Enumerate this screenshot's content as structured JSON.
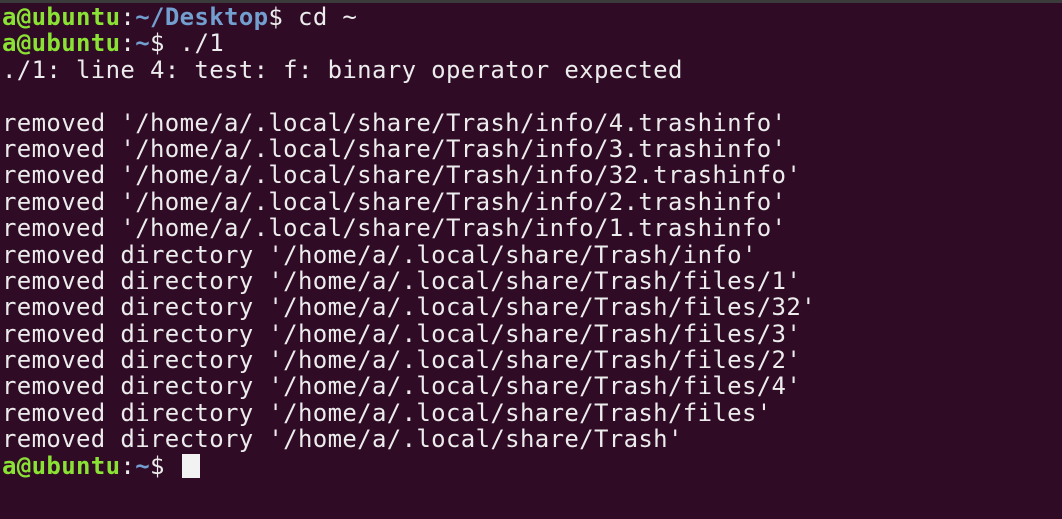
{
  "prompts": [
    {
      "user": "a@ubuntu",
      "sep": ":",
      "path": "~/Desktop",
      "symbol": "$ ",
      "command": "cd ~"
    },
    {
      "user": "a@ubuntu",
      "sep": ":",
      "path": "~",
      "symbol": "$ ",
      "command": "./1"
    },
    {
      "user": "a@ubuntu",
      "sep": ":",
      "path": "~",
      "symbol": "$ ",
      "command": ""
    }
  ],
  "output": {
    "error": "./1: line 4: test: f: binary operator expected",
    "blank": "",
    "removed": [
      "removed '/home/a/.local/share/Trash/info/4.trashinfo'",
      "removed '/home/a/.local/share/Trash/info/3.trashinfo'",
      "removed '/home/a/.local/share/Trash/info/32.trashinfo'",
      "removed '/home/a/.local/share/Trash/info/2.trashinfo'",
      "removed '/home/a/.local/share/Trash/info/1.trashinfo'",
      "removed directory '/home/a/.local/share/Trash/info'",
      "removed directory '/home/a/.local/share/Trash/files/1'",
      "removed directory '/home/a/.local/share/Trash/files/32'",
      "removed directory '/home/a/.local/share/Trash/files/3'",
      "removed directory '/home/a/.local/share/Trash/files/2'",
      "removed directory '/home/a/.local/share/Trash/files/4'",
      "removed directory '/home/a/.local/share/Trash/files'",
      "removed directory '/home/a/.local/share/Trash'"
    ]
  },
  "colors": {
    "background": "#2f0b25",
    "text": "#ececec",
    "user": "#8ae234",
    "path": "#729fcf",
    "cursor": "#f2f2f2"
  }
}
